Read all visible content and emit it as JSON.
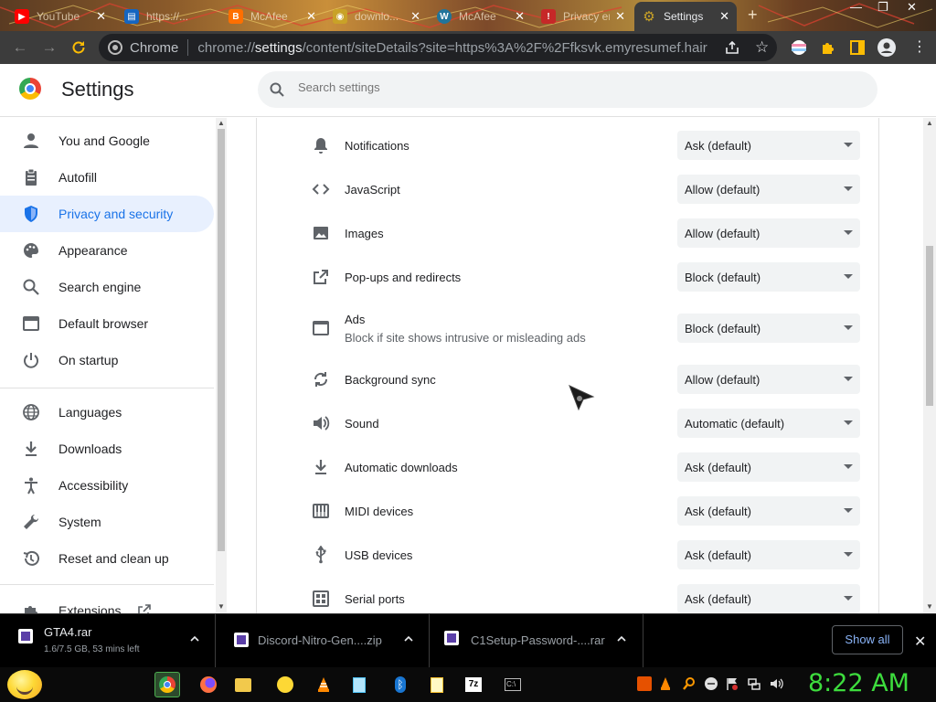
{
  "browser": {
    "tabs": [
      {
        "title": "YouTube",
        "favicon_color": "#ff0000",
        "glyph": "▶"
      },
      {
        "title": "https://...",
        "favicon_color": "#1565c0",
        "glyph": "▤"
      },
      {
        "title": "McAfee",
        "favicon_color": "#ff6f00",
        "glyph": "B"
      },
      {
        "title": "downlo...",
        "favicon_color": "#c9a227",
        "glyph": "◉"
      },
      {
        "title": "McAfee",
        "favicon_color": "#21759b",
        "glyph": "W"
      },
      {
        "title": "Privacy error",
        "favicon_color": "#c62828",
        "glyph": "!"
      },
      {
        "title": "Settings",
        "favicon_color": "#9e9e9e",
        "glyph": "⚙"
      }
    ],
    "new_tab": "+",
    "chip_label": "Chrome",
    "url_prefix": "chrome://",
    "url_bold": "settings",
    "url_rest": "/content/siteDetails?site=https%3A%2F%2Ffksvk.emyresumef.hair"
  },
  "header": {
    "title": "Settings",
    "search_placeholder": "Search settings"
  },
  "sidebar": {
    "items": [
      {
        "label": "You and Google",
        "icon": "person-icon"
      },
      {
        "label": "Autofill",
        "icon": "clipboard-icon"
      },
      {
        "label": "Privacy and security",
        "icon": "shield-icon",
        "active": true
      },
      {
        "label": "Appearance",
        "icon": "palette-icon"
      },
      {
        "label": "Search engine",
        "icon": "search-icon"
      },
      {
        "label": "Default browser",
        "icon": "browser-icon"
      },
      {
        "label": "On startup",
        "icon": "power-icon"
      },
      {
        "label": "Languages",
        "icon": "globe-icon"
      },
      {
        "label": "Downloads",
        "icon": "download-icon"
      },
      {
        "label": "Accessibility",
        "icon": "accessibility-icon"
      },
      {
        "label": "System",
        "icon": "wrench-icon"
      },
      {
        "label": "Reset and clean up",
        "icon": "restore-icon"
      },
      {
        "label": "Extensions",
        "icon": "puzzle-icon"
      }
    ]
  },
  "permissions": [
    {
      "name": "Notifications",
      "value": "Ask (default)",
      "icon": "bell-icon"
    },
    {
      "name": "JavaScript",
      "value": "Allow (default)",
      "icon": "code-icon"
    },
    {
      "name": "Images",
      "value": "Allow (default)",
      "icon": "image-icon"
    },
    {
      "name": "Pop-ups and redirects",
      "value": "Block (default)",
      "icon": "external-link-icon"
    },
    {
      "name": "Ads",
      "desc": "Block if site shows intrusive or misleading ads",
      "value": "Block (default)",
      "icon": "ads-window-icon"
    },
    {
      "name": "Background sync",
      "value": "Allow (default)",
      "icon": "sync-icon"
    },
    {
      "name": "Sound",
      "value": "Automatic (default)",
      "icon": "speaker-icon"
    },
    {
      "name": "Automatic downloads",
      "value": "Ask (default)",
      "icon": "download-icon"
    },
    {
      "name": "MIDI devices",
      "value": "Ask (default)",
      "icon": "piano-icon"
    },
    {
      "name": "USB devices",
      "value": "Ask (default)",
      "icon": "usb-icon"
    },
    {
      "name": "Serial ports",
      "value": "Ask (default)",
      "icon": "serial-port-icon"
    }
  ],
  "downloads": {
    "items": [
      {
        "name": "GTA4.rar",
        "status": "1.6/7.5 GB, 53 mins left"
      },
      {
        "name": "Discord-Nitro-Gen....zip"
      },
      {
        "name": "C1Setup-Password-....rar"
      }
    ],
    "show_all": "Show all",
    "close": "✕"
  },
  "taskbar": {
    "clock": "8:22 AM",
    "apps": [
      "chrome-icon",
      "firefox-icon",
      "folder-icon",
      "smiley-icon",
      "vlc-icon",
      "notepad-icon",
      "bluetooth-icon",
      "notes-icon",
      "7zip-icon",
      "cmd-icon"
    ]
  },
  "colors": {
    "accent": "#1a73e8",
    "active_bg": "#e8f0fe",
    "clock": "#3ddc3d"
  }
}
